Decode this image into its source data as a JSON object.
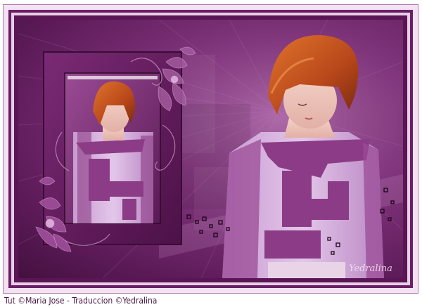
{
  "footer": {
    "credit": "Tut ©Maria Jose - Traduccion ©Yedralina"
  },
  "artwork": {
    "signature": "Yedralina",
    "palette": {
      "deep_purple": "#5a1555",
      "mid_purple": "#84357f",
      "light_lilac": "#dcb6e0",
      "hair_copper": "#c6561d",
      "frame_light": "#f3e3f2"
    }
  }
}
